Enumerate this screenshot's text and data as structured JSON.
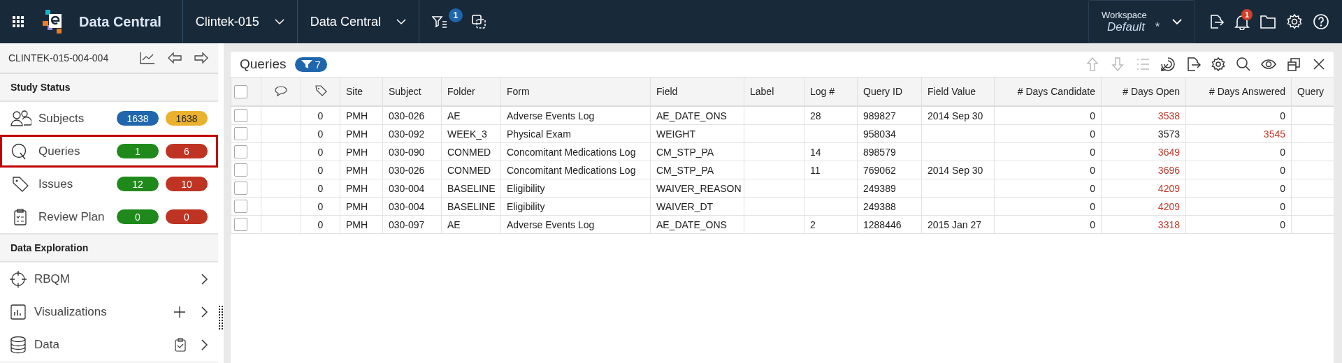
{
  "topbar": {
    "app_title": "Data Central",
    "filter_badge": "1",
    "dropdowns": [
      {
        "label": "Clintek-015"
      },
      {
        "label": "Data Central"
      }
    ],
    "workspace": {
      "label": "Workspace",
      "value": "Default",
      "modified": "*"
    },
    "notification_badge": "1"
  },
  "sidebar": {
    "record_id": "CLINTEK-015-004-004",
    "study_status": {
      "title": "Study Status",
      "items": [
        {
          "kind": "subjects",
          "label": "Subjects",
          "selected": false,
          "badges": [
            {
              "text": "1638",
              "color": "#1f66ad"
            },
            {
              "text": "1638",
              "color": "#eab12e"
            }
          ]
        },
        {
          "kind": "queries",
          "label": "Queries",
          "selected": true,
          "badges": [
            {
              "text": "1",
              "color": "#1f8a1b"
            },
            {
              "text": "6",
              "color": "#bf3322"
            }
          ]
        },
        {
          "kind": "issues",
          "label": "Issues",
          "selected": false,
          "badges": [
            {
              "text": "12",
              "color": "#1f8a1b"
            },
            {
              "text": "10",
              "color": "#bf3322"
            }
          ]
        },
        {
          "kind": "review",
          "label": "Review Plan",
          "selected": false,
          "badges": [
            {
              "text": "0",
              "color": "#1f8a1b"
            },
            {
              "text": "0",
              "color": "#bf3322"
            }
          ]
        }
      ]
    },
    "data_exploration": {
      "title": "Data Exploration",
      "items": [
        {
          "kind": "rbqm",
          "label": "RBQM"
        },
        {
          "kind": "visualizations",
          "label": "Visualizations"
        },
        {
          "kind": "data",
          "label": "Data"
        }
      ]
    }
  },
  "panel": {
    "title": "Queries",
    "filter_count": "7",
    "toolbar": [
      {
        "kind": "up",
        "disabled": true
      },
      {
        "kind": "down",
        "disabled": true
      },
      {
        "kind": "list",
        "disabled": true
      },
      {
        "kind": "radar",
        "disabled": false
      },
      {
        "kind": "export",
        "disabled": false
      },
      {
        "kind": "settings",
        "disabled": false
      },
      {
        "kind": "search",
        "disabled": false
      },
      {
        "kind": "eye",
        "disabled": false
      },
      {
        "kind": "windows",
        "disabled": false
      },
      {
        "kind": "close",
        "disabled": false
      }
    ],
    "select_all": {
      "checked": false
    },
    "columns": [
      {
        "kind": "check"
      },
      {
        "kind": "comment"
      },
      {
        "kind": "tag"
      },
      {
        "kind": "text",
        "label": "Site"
      },
      {
        "kind": "text",
        "label": "Subject"
      },
      {
        "kind": "text",
        "label": "Folder"
      },
      {
        "kind": "text",
        "label": "Form"
      },
      {
        "kind": "text",
        "label": "Field"
      },
      {
        "kind": "text",
        "label": "Label"
      },
      {
        "kind": "text",
        "label": "Log #"
      },
      {
        "kind": "text",
        "label": "Query ID"
      },
      {
        "kind": "text",
        "label": "Field Value"
      },
      {
        "kind": "number",
        "label": "# Days Candidate"
      },
      {
        "kind": "number",
        "label": "# Days Open"
      },
      {
        "kind": "number",
        "label": "# Days Answered"
      },
      {
        "kind": "text",
        "label": "Query"
      }
    ],
    "rows": [
      {
        "checked": false,
        "cells": [
          "",
          "",
          "0",
          "PMH",
          "030-026",
          "AE",
          "Adverse Events Log",
          "AE_DATE_ONS",
          "",
          "28",
          "989827",
          "2014 Sep 30",
          {
            "text": "0",
            "alert": false
          },
          {
            "text": "3538",
            "alert": true
          },
          {
            "text": "0",
            "alert": false
          },
          ""
        ]
      },
      {
        "checked": false,
        "cells": [
          "",
          "",
          "0",
          "PMH",
          "030-092",
          "WEEK_3",
          "Physical Exam",
          "WEIGHT",
          "",
          "",
          "958034",
          "",
          {
            "text": "0",
            "alert": false
          },
          {
            "text": "3573",
            "alert": false
          },
          {
            "text": "3545",
            "alert": true
          },
          ""
        ]
      },
      {
        "checked": false,
        "cells": [
          "",
          "",
          "0",
          "PMH",
          "030-090",
          "CONMED",
          "Concomitant Medications Log",
          "CM_STP_PA",
          "",
          "14",
          "898579",
          "",
          {
            "text": "0",
            "alert": false
          },
          {
            "text": "3649",
            "alert": true
          },
          {
            "text": "0",
            "alert": false
          },
          ""
        ]
      },
      {
        "checked": false,
        "cells": [
          "",
          "",
          "0",
          "PMH",
          "030-026",
          "CONMED",
          "Concomitant Medications Log",
          "CM_STP_PA",
          "",
          "11",
          "769062",
          "2014 Sep 30",
          {
            "text": "0",
            "alert": false
          },
          {
            "text": "3696",
            "alert": true
          },
          {
            "text": "0",
            "alert": false
          },
          ""
        ]
      },
      {
        "checked": false,
        "cells": [
          "",
          "",
          "0",
          "PMH",
          "030-004",
          "BASELINE",
          "Eligibility",
          "WAIVER_REASON",
          "",
          "",
          "249389",
          "",
          {
            "text": "0",
            "alert": false
          },
          {
            "text": "4209",
            "alert": true
          },
          {
            "text": "0",
            "alert": false
          },
          ""
        ]
      },
      {
        "checked": false,
        "cells": [
          "",
          "",
          "0",
          "PMH",
          "030-004",
          "BASELINE",
          "Eligibility",
          "WAIVER_DT",
          "",
          "",
          "249388",
          "",
          {
            "text": "0",
            "alert": false
          },
          {
            "text": "4209",
            "alert": true
          },
          {
            "text": "0",
            "alert": false
          },
          ""
        ]
      },
      {
        "checked": false,
        "cells": [
          "",
          "",
          "0",
          "PMH",
          "030-097",
          "AE",
          "Adverse Events Log",
          "AE_DATE_ONS",
          "",
          "2",
          "1288446",
          "2015 Jan 27",
          {
            "text": "0",
            "alert": false
          },
          {
            "text": "3318",
            "alert": true
          },
          {
            "text": "0",
            "alert": false
          },
          ""
        ]
      }
    ]
  }
}
